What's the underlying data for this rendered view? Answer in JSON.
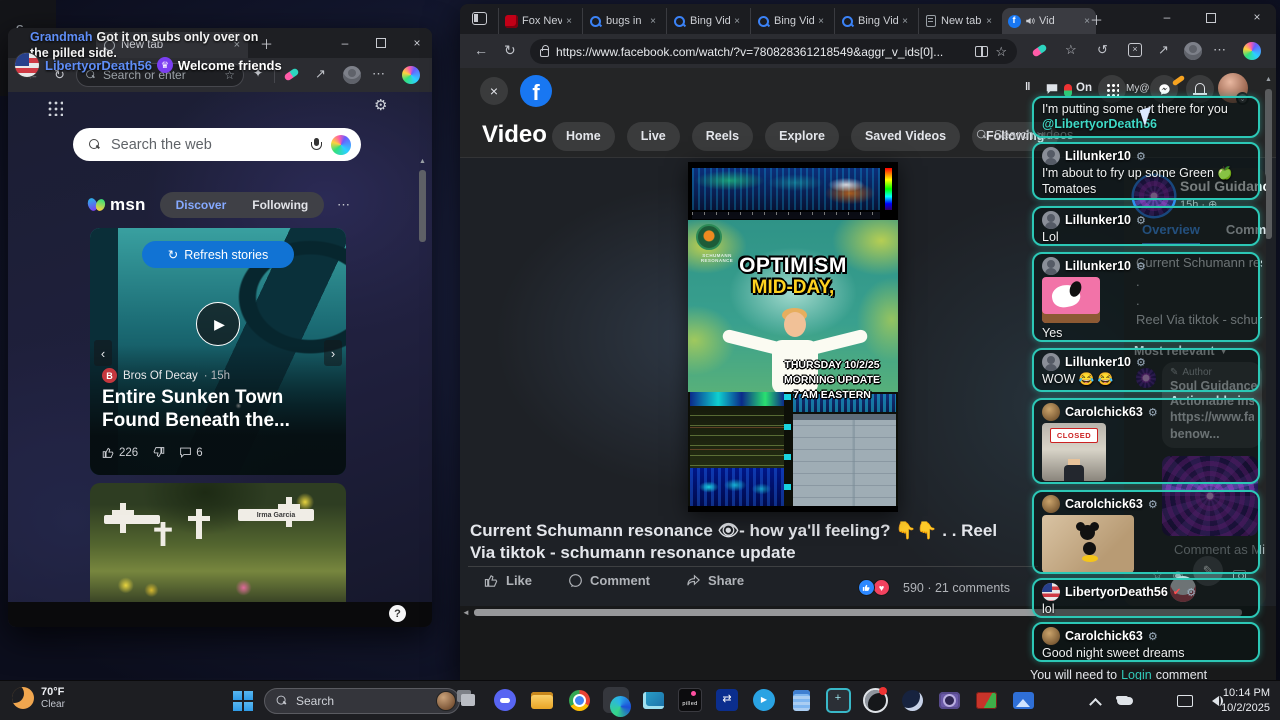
{
  "icons": {
    "back": "←",
    "refresh": "↻",
    "star": "☆",
    "more": "⋯",
    "close": "×",
    "plus": "＋",
    "minimize": "–",
    "gear": "⚙",
    "play": "▶",
    "prev": "‹",
    "next": "›",
    "pause": "‖",
    "chev_down": "⌄",
    "crown": "♛",
    "check": "✔",
    "globe": "⊕",
    "dropdown": "▼",
    "left_arrow": "◄",
    "up_arrow": "▲",
    "question": "?",
    "edit": "✎",
    "swirl": "◉",
    "sticker": "☆",
    "fb_f": "f",
    "heart": "♥"
  },
  "desktop": {
    "stray_glyph": "G"
  },
  "taskbar": {
    "weather": {
      "temp": "70°F",
      "condition": "Clear"
    },
    "search_placeholder": "Search",
    "clock": {
      "time": "10:14 PM",
      "date": "10/2/2025"
    },
    "icons": [
      {
        "name": "task-view"
      },
      {
        "name": "discord"
      },
      {
        "name": "file-explorer"
      },
      {
        "name": "chrome"
      },
      {
        "name": "edge",
        "state": "active"
      },
      {
        "name": "media-player"
      },
      {
        "name": "pilled",
        "label": "pilled"
      },
      {
        "name": "teamviewer"
      },
      {
        "name": "telegram"
      },
      {
        "name": "notepad"
      },
      {
        "name": "snipping-tool"
      },
      {
        "name": "obs",
        "note": "note"
      },
      {
        "name": "steam"
      },
      {
        "name": "camera"
      },
      {
        "name": "irfanview"
      },
      {
        "name": "photos"
      }
    ],
    "tray": [
      {
        "name": "tray-expand"
      },
      {
        "name": "onedrive"
      },
      {
        "name": "microphone"
      },
      {
        "name": "display"
      },
      {
        "name": "speaker"
      }
    ]
  },
  "left_window": {
    "tab_title": "New tab",
    "toast1": {
      "user": "Grandmah",
      "text": "Got it on subs only over on the pilled side."
    },
    "toast2": {
      "user": "LibertyorDeath56",
      "text": "Welcome friends"
    },
    "address_placeholder": "Search or enter",
    "msn": {
      "search_placeholder": "Search the web",
      "brand": "msn",
      "feed_tabs": [
        {
          "label": "Discover",
          "state": "active"
        },
        {
          "label": "Following"
        }
      ],
      "refresh_button": "Refresh stories",
      "story": {
        "source": "Bros Of Decay",
        "time": "· 15h",
        "title": "Entire Sunken Town Found Beneath the...",
        "likes": "226",
        "comments": "6"
      },
      "memorial_label": "Irma Garcia"
    }
  },
  "right_window": {
    "tab_strip": [
      {
        "label": "Fox Nev",
        "icon": "fox"
      },
      {
        "label": "bugs in",
        "icon": "bing"
      },
      {
        "label": "Bing Vid",
        "icon": "bing"
      },
      {
        "label": "Bing Vid",
        "icon": "bing"
      },
      {
        "label": "Bing Vid",
        "icon": "bing"
      },
      {
        "label": "New tab",
        "icon": "newtab"
      },
      {
        "label": "Vid",
        "icon": "facebook",
        "state": "active",
        "audio": true
      }
    ],
    "url": "https://www.facebook.com/watch/?v=780828361218549&aggr_v_ids[0]...",
    "facebook": {
      "section_title": "Video",
      "nav_pills": [
        {
          "label": "Home"
        },
        {
          "label": "Live"
        },
        {
          "label": "Reels"
        },
        {
          "label": "Explore"
        },
        {
          "label": "Saved Videos"
        },
        {
          "label": "Following"
        }
      ],
      "search_videos": "Search videos",
      "status_on": "On",
      "header_badge": "My@",
      "video": {
        "overlay_title": "OPTIMISM",
        "overlay_subtitle": "MID-DAY,",
        "watermark": "SCHUMANN RESONANCE",
        "schedule_lines": [
          "THURSDAY 10/2/25",
          "MORNING UPDATE",
          "7 AM EASTERN"
        ]
      },
      "caption": "Current Schumann resonance 👁- how ya'll feeling? 👇👇 . . Reel Via tiktok - schumann resonance update",
      "actions": [
        {
          "label": "Like",
          "like": true
        },
        {
          "label": "Comment",
          "comment": true
        },
        {
          "label": "Share",
          "share": true
        }
      ],
      "engagement": "590 · 21 comments",
      "page_panel": {
        "name": "Soul Guidance",
        "meta": "15h ·",
        "tabs": [
          {
            "label": "Overview",
            "state": "active"
          },
          {
            "label": "Comm"
          }
        ],
        "post_lines": [
          "Current Schumann resc",
          ".",
          ".",
          "Reel Via tiktok - schum"
        ],
        "sort_label": "Most relevant",
        "author_badge": "Author",
        "author_name": "Soul Guidance",
        "author_lines": [
          "Actionable insig",
          "https://www.fa",
          "benow..."
        ],
        "comment_placeholder": "Comment as Mi"
      },
      "login_notice": {
        "prefix": "You will need to",
        "link": "Login",
        "suffix": "comment"
      }
    },
    "chat_overlay": [
      {
        "text": "I'm putting some out there for you",
        "mention": "@LibertyorDeath56"
      },
      {
        "user": "Lillunker10",
        "avatar": "lill",
        "text": "I'm about to fry up some Green 🍏 Tomatoes"
      },
      {
        "user": "Lillunker10",
        "avatar": "lill",
        "text": "Lol"
      },
      {
        "user": "Lillunker10",
        "avatar": "lill",
        "image": "snoopy",
        "text": "Yes"
      },
      {
        "user": "Lillunker10",
        "avatar": "lill",
        "text": "WOW 😂 😂"
      },
      {
        "user": "Carolchick63",
        "avatar": "carol",
        "image": "closed",
        "image_label": "CLOSED"
      },
      {
        "user": "Carolchick63",
        "avatar": "carol",
        "image": "mickey"
      },
      {
        "user": "LibertyorDeath56",
        "avatar": "liberty",
        "verified": true,
        "text": "lol"
      },
      {
        "user": "Carolchick63",
        "avatar": "carol",
        "text": "Good night sweet dreams"
      }
    ]
  }
}
